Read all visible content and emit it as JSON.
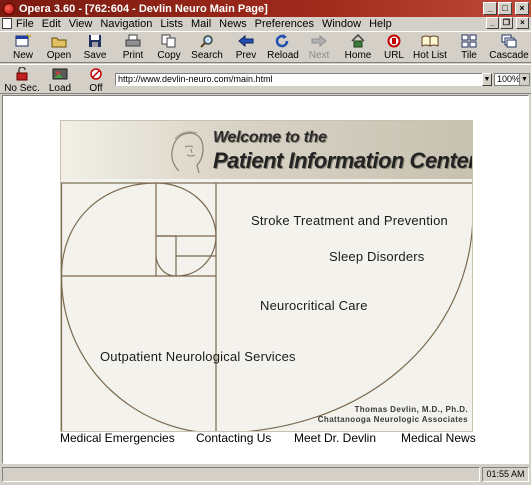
{
  "window": {
    "title": "Opera 3.60 - [762:604 - Devlin Neuro Main Page]"
  },
  "menu": [
    "File",
    "Edit",
    "View",
    "Navigation",
    "Lists",
    "Mail",
    "News",
    "Preferences",
    "Window",
    "Help"
  ],
  "toolbar": {
    "new": "New",
    "open": "Open",
    "save": "Save",
    "print": "Print",
    "copy": "Copy",
    "search": "Search",
    "prev": "Prev",
    "reload": "Reload",
    "next": "Next",
    "home": "Home",
    "url": "URL",
    "hotlist": "Hot List",
    "tile": "Tile",
    "cascade": "Cascade"
  },
  "toolbar2": {
    "nosec": "No Sec.",
    "load": "Load",
    "off": "Off"
  },
  "address": {
    "url": "http://www.devlin-neuro.com/main.html",
    "zoom": "100%"
  },
  "banner": {
    "title_line1": "Welcome to the",
    "title_line2": "Patient Information Center",
    "links": {
      "stroke": "Stroke Treatment and Prevention",
      "sleep": "Sleep Disorders",
      "neurocritical": "Neurocritical Care",
      "outpatient": "Outpatient Neurological Services"
    },
    "credit_line1": "Thomas Devlin, M.D., Ph.D.",
    "credit_line2": "Chattanooga Neurologic Associates"
  },
  "bottom_nav": {
    "emergencies": "Medical Emergencies",
    "contacting": "Contacting Us",
    "meet": "Meet Dr. Devlin",
    "news": "Medical News"
  },
  "status": {
    "clock": "01:55 AM"
  },
  "colors": {
    "titlebar": "#a02a1c",
    "chrome": "#d4d0c8",
    "spiral": "#7a6a50"
  }
}
